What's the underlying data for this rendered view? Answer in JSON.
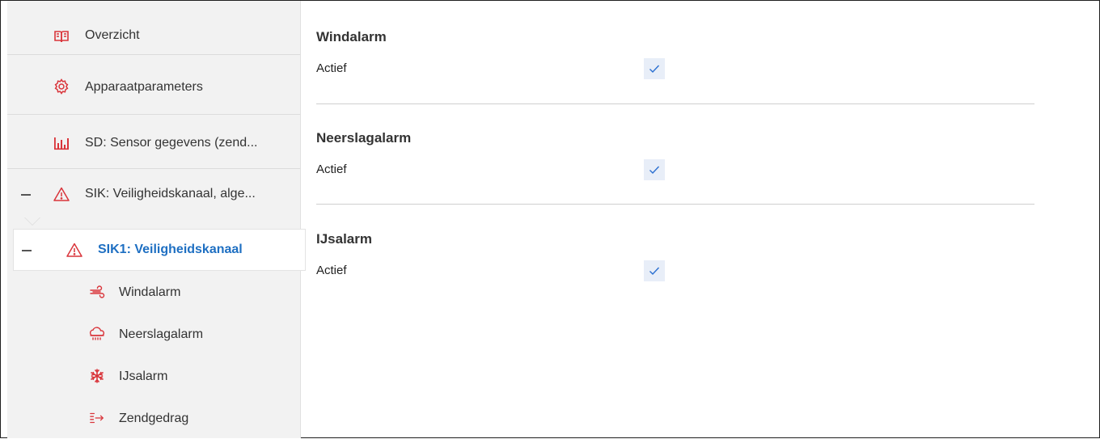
{
  "sidebar": {
    "items": [
      {
        "label": "Overzicht",
        "icon": "book-icon"
      },
      {
        "label": "Apparaatparameters",
        "icon": "gear-icon"
      },
      {
        "label": "SD: Sensor gegevens (zend...",
        "icon": "bar-chart-icon"
      },
      {
        "label": "SIK: Veiligheidskanaal, alge...",
        "icon": "warning-icon"
      },
      {
        "label": "SIK1:  Veiligheidskanaal",
        "icon": "warning-icon"
      },
      {
        "label": "Windalarm",
        "icon": "wind-icon"
      },
      {
        "label": "Neerslagalarm",
        "icon": "rain-cloud-icon"
      },
      {
        "label": "IJsalarm",
        "icon": "snowflake-icon"
      },
      {
        "label": "Zendgedrag",
        "icon": "send-list-icon"
      }
    ]
  },
  "main": {
    "sections": [
      {
        "title": "Windalarm",
        "row_label": "Actief",
        "checked": true
      },
      {
        "title": "Neerslagalarm",
        "row_label": "Actief",
        "checked": true
      },
      {
        "title": "IJsalarm",
        "row_label": "Actief",
        "checked": true
      }
    ]
  },
  "colors": {
    "accent": "#1e6fc2",
    "icon_red": "#d9343a",
    "sidebar_bg": "#f2f2f2",
    "checkbox_bg": "#e8eef8"
  }
}
